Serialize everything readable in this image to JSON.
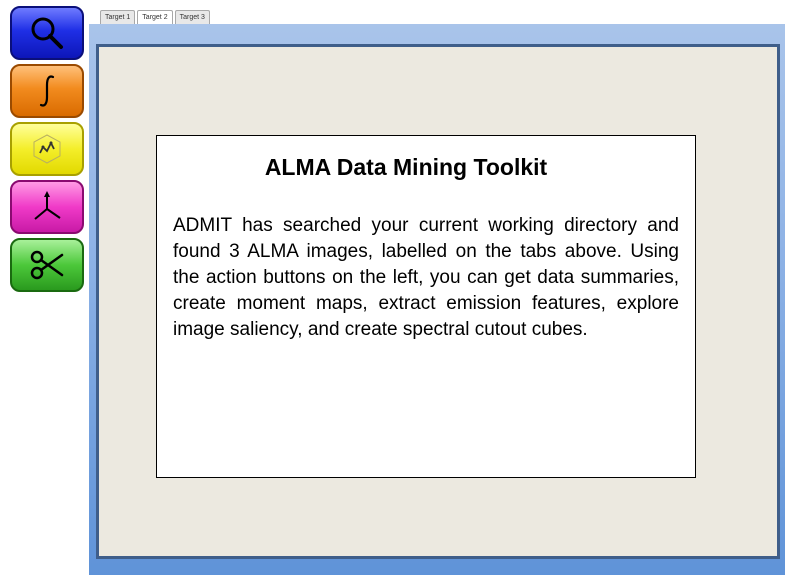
{
  "toolbar": {
    "buttons": [
      {
        "name": "summary",
        "icon": "magnifier-icon",
        "color": "#1f2fe6"
      },
      {
        "name": "moment",
        "icon": "integral-icon",
        "color": "#f28b1e"
      },
      {
        "name": "feature",
        "icon": "feature-cube-icon",
        "color": "#f4ee2a"
      },
      {
        "name": "saliency",
        "icon": "axes-icon",
        "color": "#f03ac8"
      },
      {
        "name": "cutout",
        "icon": "scissors-icon",
        "color": "#4cc83a"
      }
    ]
  },
  "tabs": [
    {
      "label": "Target 1",
      "active": false
    },
    {
      "label": "Target 2",
      "active": true
    },
    {
      "label": "Target 3",
      "active": false
    }
  ],
  "panel": {
    "background": "#ece9e0",
    "frame_color": "#8fb3e6"
  },
  "intro": {
    "title": "ALMA Data Mining Toolkit",
    "text": "ADMIT has searched your current working directory and found 3 ALMA images, labelled on the tabs above.  Using the action buttons on the left, you can get data summaries, create moment maps, extract emission features, explore image saliency, and create spectral cutout cubes."
  }
}
